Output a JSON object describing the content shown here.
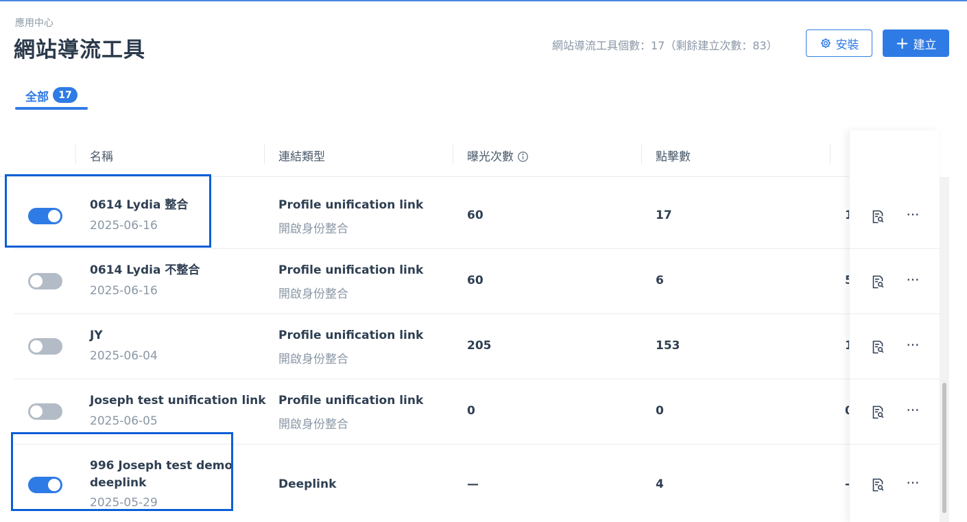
{
  "header": {
    "breadcrumb": "應用中心",
    "title": "網站導流工具",
    "quota_text": "網站導流工具個數：17（剩餘建立次數：83）",
    "install_label": "安裝",
    "create_label": "建立",
    "create_icon": "+"
  },
  "tabs": [
    {
      "label": "全部",
      "count": "17",
      "active": true
    }
  ],
  "table": {
    "columns": [
      "名稱",
      "連結類型",
      "曝光次數",
      "點擊數"
    ],
    "rows": [
      {
        "enabled": true,
        "name": "0614 Lydia 整合",
        "date": "2025-06-16",
        "link_type": "Profile unification link",
        "link_sub": "開啟身份整合",
        "impressions": "60",
        "clicks": "17",
        "clipped": "1"
      },
      {
        "enabled": false,
        "name": "0614 Lydia 不整合",
        "date": "2025-06-16",
        "link_type": "Profile unification link",
        "link_sub": "開啟身份整合",
        "impressions": "60",
        "clicks": "6",
        "clipped": "5"
      },
      {
        "enabled": false,
        "name": "JY",
        "date": "2025-06-04",
        "link_type": "Profile unification link",
        "link_sub": "開啟身份整合",
        "impressions": "205",
        "clicks": "153",
        "clipped": "1"
      },
      {
        "enabled": false,
        "name": "Joseph test unification link",
        "date": "2025-06-05",
        "link_type": "Profile unification link",
        "link_sub": "開啟身份整合",
        "impressions": "0",
        "clicks": "0",
        "clipped": "0"
      },
      {
        "enabled": true,
        "name": "996 Joseph test demo deeplink",
        "date": "2025-05-29",
        "link_type": "Deeplink",
        "link_sub": "",
        "impressions": "—",
        "clicks": "4",
        "clipped": "-"
      }
    ],
    "row_actions": {
      "more_label": "···"
    }
  },
  "colors": {
    "accent": "#2f7be5",
    "highlight_box": "#0b5ed7"
  },
  "icons": [
    "gear-icon",
    "plus-icon",
    "info-icon",
    "report-icon",
    "more-icon"
  ]
}
